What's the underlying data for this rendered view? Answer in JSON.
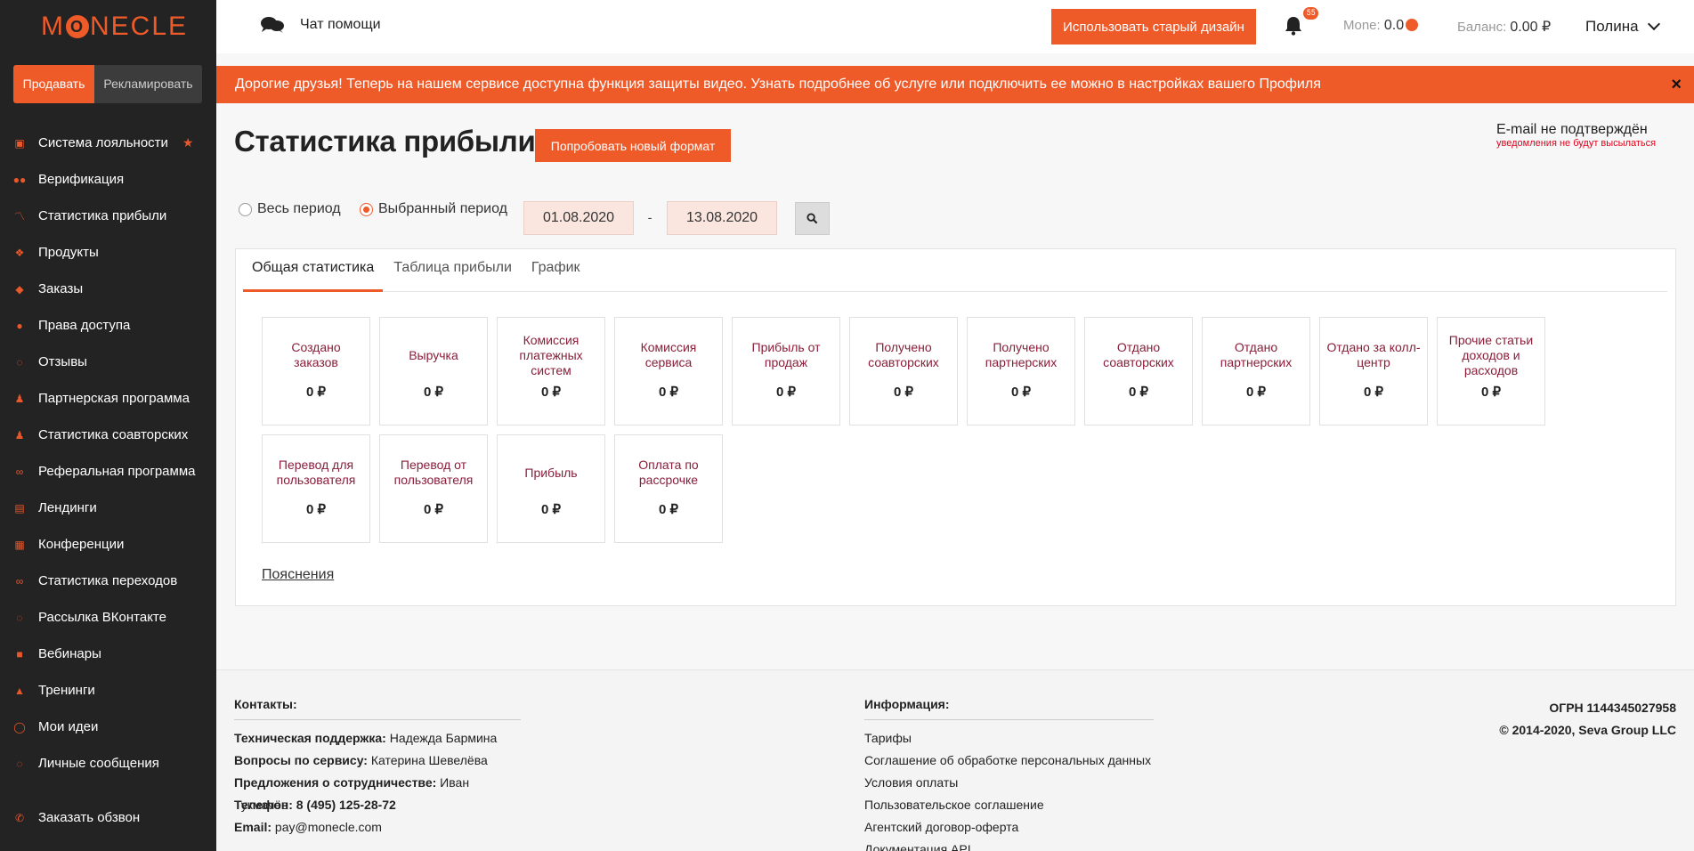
{
  "sidebar": {
    "logo": "M",
    "logo_o": "O",
    "logo_rest": "NECLE",
    "switch": {
      "sell": "Продавать",
      "advertise": "Рекламировать"
    },
    "items": [
      {
        "label": "Система лояльности",
        "icon": "camera-icon"
      },
      {
        "label": "Верификация",
        "icon": "users-icon"
      },
      {
        "label": "Статистика прибыли",
        "icon": "chart-line-icon"
      },
      {
        "label": "Продукты",
        "icon": "cubes-icon"
      },
      {
        "label": "Заказы",
        "icon": "tags-icon"
      },
      {
        "label": "Права доступа",
        "icon": "info-circle-icon"
      },
      {
        "label": "Отзывы",
        "icon": "comments-icon"
      },
      {
        "label": "Партнерская программа",
        "icon": "user-plus-icon"
      },
      {
        "label": "Статистика соавторских",
        "icon": "user-plus-icon"
      },
      {
        "label": "Реферальная программа",
        "icon": "link-icon"
      },
      {
        "label": "Лендинги",
        "icon": "file-icon"
      },
      {
        "label": "Конференции",
        "icon": "calendar-icon"
      },
      {
        "label": "Статистика переходов",
        "icon": "link-icon"
      },
      {
        "label": "Рассылка ВКонтакте",
        "icon": "comments-icon"
      },
      {
        "label": "Вебинары",
        "icon": "video-icon"
      },
      {
        "label": "Тренинги",
        "icon": "graduation-cap-icon"
      },
      {
        "label": "Мои идеи",
        "icon": "lightbulb-icon"
      },
      {
        "label": "Личные сообщения",
        "icon": "comments-icon"
      }
    ],
    "call": "Заказать обзвон"
  },
  "topbar": {
    "chat": "Чат помощи",
    "old_design": "Использовать старый дизайн",
    "notifications": "55",
    "mone_label": "Mone:",
    "mone_value": "0.0",
    "balance_label": "Баланс:",
    "balance_value": "0.00 ₽",
    "user": "Полина"
  },
  "notice": {
    "text": "Дорогие друзья! Теперь на нашем сервисе доступна функция защиты видео. Узнать подробнее об услуге или подключить ее можно в настройках вашего Профиля",
    "close": "×"
  },
  "main": {
    "title": "Статистика прибыли",
    "try_new": "Попробовать новый формат",
    "email_title": "E-mail не подтверждён",
    "email_sub": "уведомления не будут высылаться",
    "period_all": "Весь период",
    "period_selected": "Выбранный период",
    "date_from": "01.08.2020",
    "date_sep": "-",
    "date_to": "13.08.2020",
    "tabs": [
      "Общая статистика",
      "Таблица прибыли",
      "График"
    ],
    "cards": [
      {
        "label": "Создано заказов",
        "value": "0 ₽"
      },
      {
        "label": "Выручка",
        "value": "0 ₽"
      },
      {
        "label": "Комиссия платежных систем",
        "value": "0 ₽"
      },
      {
        "label": "Комиссия сервиса",
        "value": "0 ₽"
      },
      {
        "label": "Прибыль от продаж",
        "value": "0 ₽"
      },
      {
        "label": "Получено соавторских",
        "value": "0 ₽"
      },
      {
        "label": "Получено партнерских",
        "value": "0 ₽"
      },
      {
        "label": "Отдано соавторских",
        "value": "0 ₽"
      },
      {
        "label": "Отдано партнерских",
        "value": "0 ₽"
      },
      {
        "label": "Отдано за колл-центр",
        "value": "0 ₽"
      },
      {
        "label": "Прочие статьи доходов и расходов",
        "value": "0 ₽"
      },
      {
        "label": "Перевод для пользователя",
        "value": "0 ₽"
      },
      {
        "label": "Перевод от пользователя",
        "value": "0 ₽"
      },
      {
        "label": "Прибыль",
        "value": "0 ₽"
      },
      {
        "label": "Оплата по рассрочке",
        "value": "0 ₽"
      }
    ],
    "explain": "Пояснения"
  },
  "footer": {
    "contacts_title": "Контакты:",
    "contacts": [
      {
        "k": "Техническая поддержка:",
        "v": " Надежда Бармина"
      },
      {
        "k": "Вопросы по сервису:",
        "v": " Катерина Шевелёва"
      },
      {
        "k": "Предложения о сотрудничестве:",
        "v": " Иван Тукмачёв"
      },
      {
        "k": "Телефон: 8 (495) 125-28-72",
        "v": ""
      },
      {
        "k": "Email:",
        "v": " pay@monecle.com"
      }
    ],
    "info_title": "Информация:",
    "info": [
      "Тарифы",
      "Соглашение об обработке персональных данных",
      "Условия оплаты",
      "Пользовательское соглашение",
      "Агентский договор-оферта",
      "Документация API"
    ],
    "ogrn": "ОГРН 1144345027958",
    "copyright": "© 2014-2020, Seva Group LLC"
  }
}
